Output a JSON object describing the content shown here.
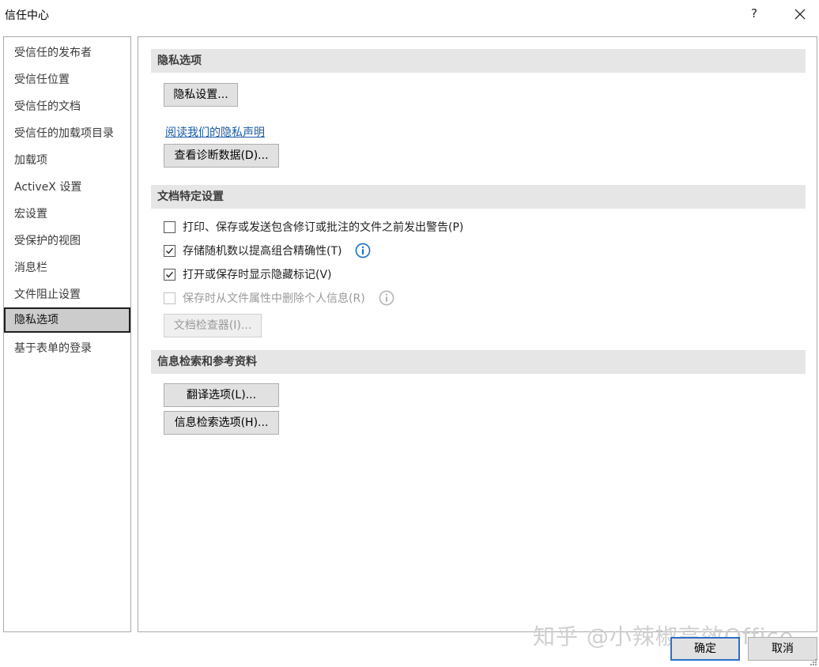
{
  "window": {
    "title": "信任中心",
    "help_label": "?",
    "close_icon": "close-icon"
  },
  "sidebar": {
    "items": [
      {
        "label": "受信任的发布者"
      },
      {
        "label": "受信任位置"
      },
      {
        "label": "受信任的文档"
      },
      {
        "label": "受信任的加载项目录"
      },
      {
        "label": "加载项"
      },
      {
        "label": "ActiveX 设置"
      },
      {
        "label": "宏设置"
      },
      {
        "label": "受保护的视图"
      },
      {
        "label": "消息栏"
      },
      {
        "label": "文件阻止设置"
      },
      {
        "label": "隐私选项",
        "selected": true
      },
      {
        "label": "基于表单的登录"
      }
    ]
  },
  "privacy": {
    "header": "隐私选项",
    "settings_button": "隐私设置...",
    "statement_link": "阅读我们的隐私声明",
    "diagnostic_button": "查看诊断数据(D)..."
  },
  "document": {
    "header": "文档特定设置",
    "options": [
      {
        "label": "打印、保存或发送包含修订或批注的文件之前发出警告(P)",
        "checked": false,
        "disabled": false,
        "info": false
      },
      {
        "label": "存储随机数以提高组合精确性(T)",
        "checked": true,
        "disabled": false,
        "info": true
      },
      {
        "label": "打开或保存时显示隐藏标记(V)",
        "checked": true,
        "disabled": false,
        "info": false
      },
      {
        "label": "保存时从文件属性中删除个人信息(R)",
        "checked": false,
        "disabled": true,
        "info": true
      }
    ],
    "inspector_button": "文档检查器(I)..."
  },
  "research": {
    "header": "信息检索和参考资料",
    "translate_button": "翻译选项(L)...",
    "research_button": "信息检索选项(H)..."
  },
  "footer": {
    "ok_label": "确定",
    "cancel_label": "取消",
    "watermark": "知乎 @小辣椒高效Office"
  },
  "colors": {
    "link": "#1a5aa6",
    "info_icon": "#1a6fc9",
    "selected_bg": "#cccccc",
    "ok_border": "#2a6fc9"
  }
}
